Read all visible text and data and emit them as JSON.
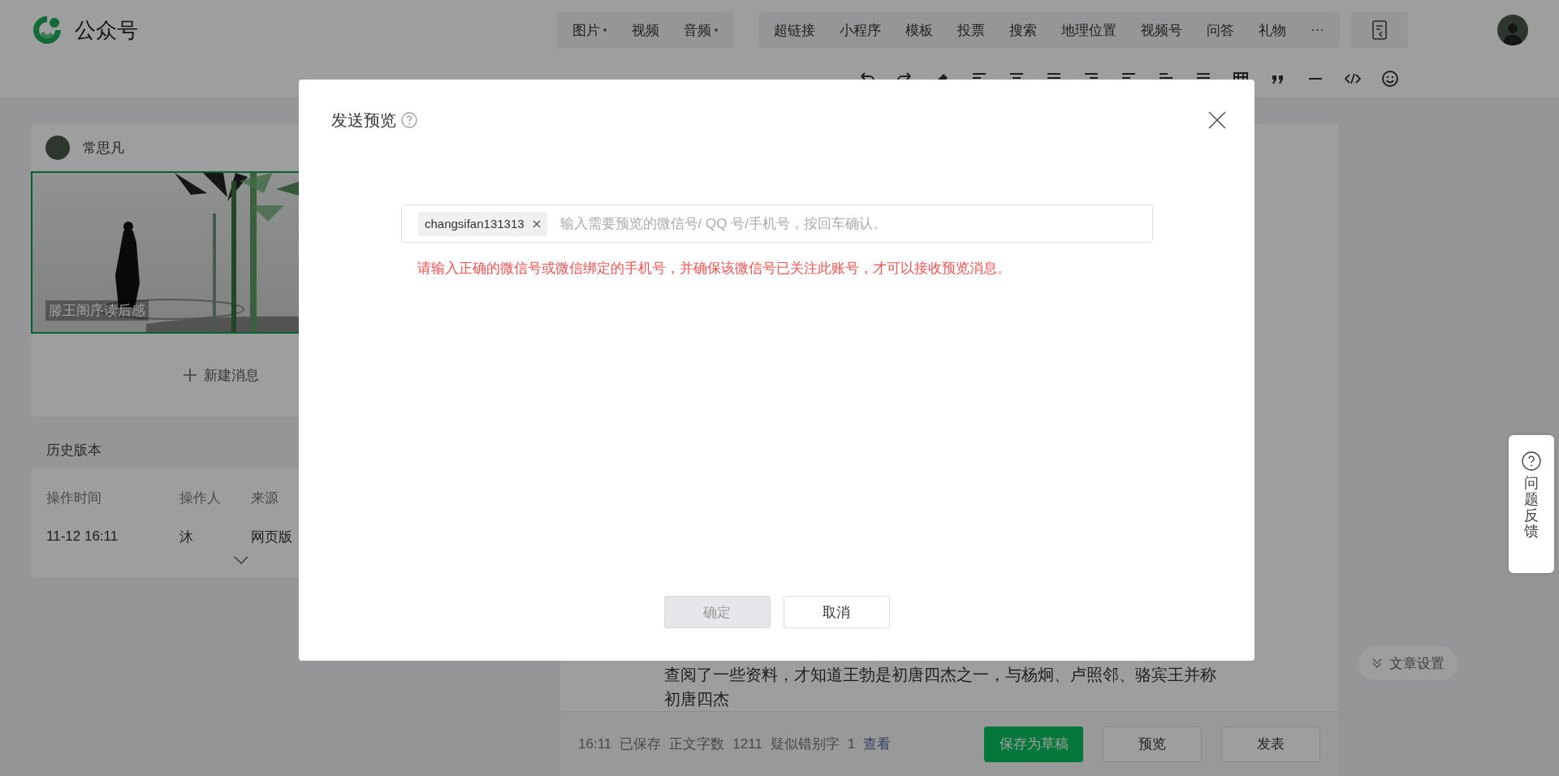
{
  "header": {
    "title": "公众号",
    "media_tools": [
      {
        "label": "图片",
        "dropdown": true
      },
      {
        "label": "视频",
        "dropdown": false
      },
      {
        "label": "音频",
        "dropdown": true
      }
    ],
    "insert_tools": [
      "超链接",
      "小程序",
      "模板",
      "投票",
      "搜索",
      "地理位置",
      "视频号",
      "问答",
      "礼物",
      "···"
    ]
  },
  "account": {
    "name": "常思凡"
  },
  "articles": [
    {
      "title": "滕王阁序读后感",
      "selected": true
    }
  ],
  "new_message": "新建消息",
  "history": {
    "title": "历史版本",
    "columns": [
      "操作时间",
      "操作人",
      "来源"
    ],
    "rows": [
      [
        "11-12 16:11",
        "沐",
        "网页版"
      ]
    ]
  },
  "editor": {
    "paragraphs": [
      "查阅了一些资料，才知道王勃是初唐四杰之一，与杨炯、卢照邻、骆宾王并称",
      "初唐四杰"
    ]
  },
  "article_settings": "文章设置",
  "status_bar": {
    "time": "16:11",
    "saved": "已保存",
    "word_count_label": "正文字数",
    "word_count": "1211",
    "typo_label": "疑似错别字",
    "typo_count": "1",
    "view_link": "查看"
  },
  "actions": [
    {
      "label": "保存为草稿",
      "kind": "primary"
    },
    {
      "label": "预览",
      "kind": "default"
    },
    {
      "label": "发表",
      "kind": "default"
    }
  ],
  "feedback": "问题反馈",
  "modal": {
    "title": "发送预览",
    "tags": [
      "changsifan131313"
    ],
    "placeholder": "输入需要预览的微信号/ QQ 号/手机号，按回车确认。",
    "error": "请输入正确的微信号或微信绑定的手机号，并确保该微信号已关注此账号，才可以接收预览消息。",
    "buttons": [
      {
        "label": "确定",
        "disabled": true
      },
      {
        "label": "取消",
        "disabled": false
      }
    ]
  }
}
